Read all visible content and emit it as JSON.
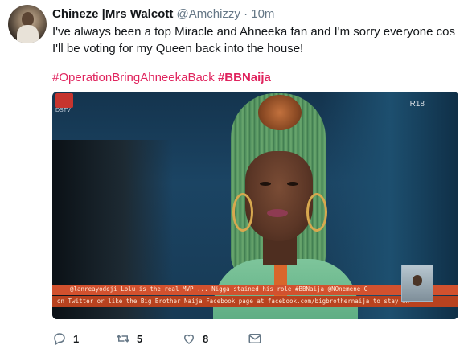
{
  "tweet": {
    "author_name": "Chineze |Mrs Walcott",
    "author_handle": "@Amchizzy",
    "separator": "·",
    "timestamp": "10m",
    "text": "I've always been a top Miracle and Ahneeka fan and I'm sorry everyone cos I'll be voting for my Queen back into the house!",
    "hashtags": [
      "#OperationBringAhneekaBack",
      "#BBNaija"
    ],
    "media": {
      "rating": "R18",
      "ticker_line1": "@lanreayodeji Lolu is the real MVP ... Nigga stained his role #BBNaija @NOnemene G",
      "ticker_line2": "on Twitter or like the Big Brother Naija Facebook page at facebook.com/bigbrothernaija to stay in"
    },
    "actions": {
      "reply_count": "1",
      "retweet_count": "5",
      "like_count": "8"
    }
  },
  "colors": {
    "hashtag": "#e0245e",
    "secondary_text": "#657786",
    "primary_text": "#14171a"
  },
  "icons": [
    "reply-icon",
    "retweet-icon",
    "like-icon",
    "direct-message-icon"
  ]
}
